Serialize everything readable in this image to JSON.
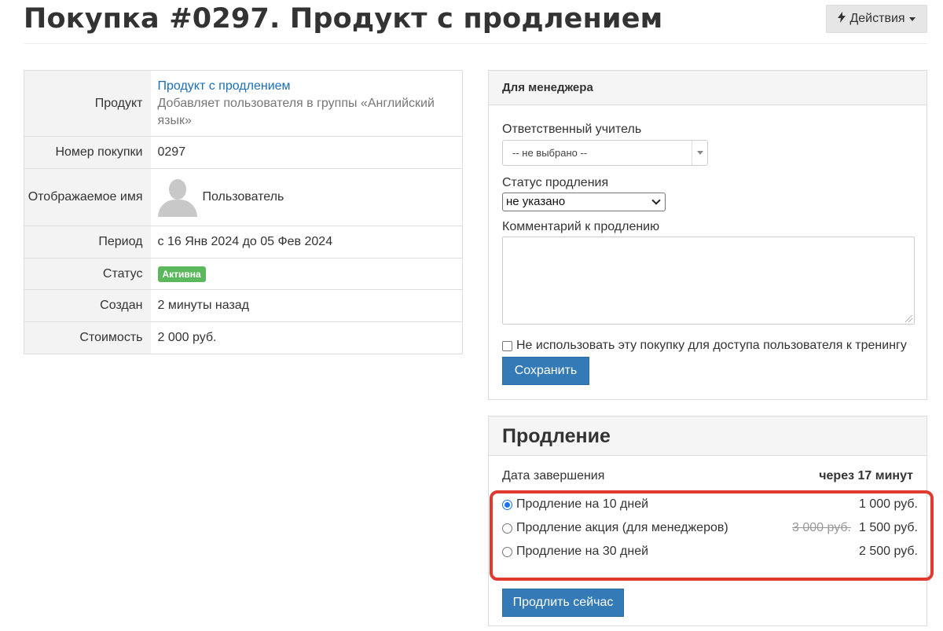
{
  "header": {
    "title": "Покупка #0297. Продукт с продлением",
    "actions_label": "Действия",
    "actions_icon": "bolt-icon"
  },
  "info": {
    "product_label": "Продукт",
    "product_name": "Продукт с продлением",
    "product_desc": "Добавляет пользователя в группы «Английский язык»",
    "number_label": "Номер покупки",
    "number_value": "0297",
    "name_label": "Отображаемое имя",
    "name_value": "Пользователь",
    "period_label": "Период",
    "period_value": "с 16 Янв 2024 до 05 Фев 2024",
    "status_label": "Статус",
    "status_value": "Активна",
    "status_color": "#5cb85c",
    "created_label": "Создан",
    "created_value": "2 минуты назад",
    "cost_label": "Стоимость",
    "cost_value": "2 000 руб."
  },
  "manager": {
    "heading": "Для менеджера",
    "teacher_label": "Ответственный учитель",
    "teacher_value": "-- не выбрано --",
    "renewal_status_label": "Статус продления",
    "renewal_status_value": "не указано",
    "comment_label": "Комментарий к продлению",
    "comment_value": "",
    "no_access_label": "Не использовать эту покупку для доступа пользователя к тренингу",
    "no_access_checked": false,
    "save_label": "Сохранить"
  },
  "renewal": {
    "heading": "Продление",
    "end_label": "Дата завершения",
    "end_value": "через 17 минут",
    "options": [
      {
        "label": "Продление на 10 дней",
        "old_price": "",
        "price": "1 000 руб.",
        "checked": true
      },
      {
        "label": "Продление акция (для менеджеров)",
        "old_price": "3 000 руб.",
        "price": "1 500 руб.",
        "checked": false
      },
      {
        "label": "Продление на 30 дней",
        "old_price": "",
        "price": "2 500 руб.",
        "checked": false
      }
    ],
    "highlight_color": "#e03a2f",
    "renew_label": "Продлить сейчас"
  },
  "colors": {
    "primary": "#337ab7",
    "link": "#1a6fb8"
  }
}
